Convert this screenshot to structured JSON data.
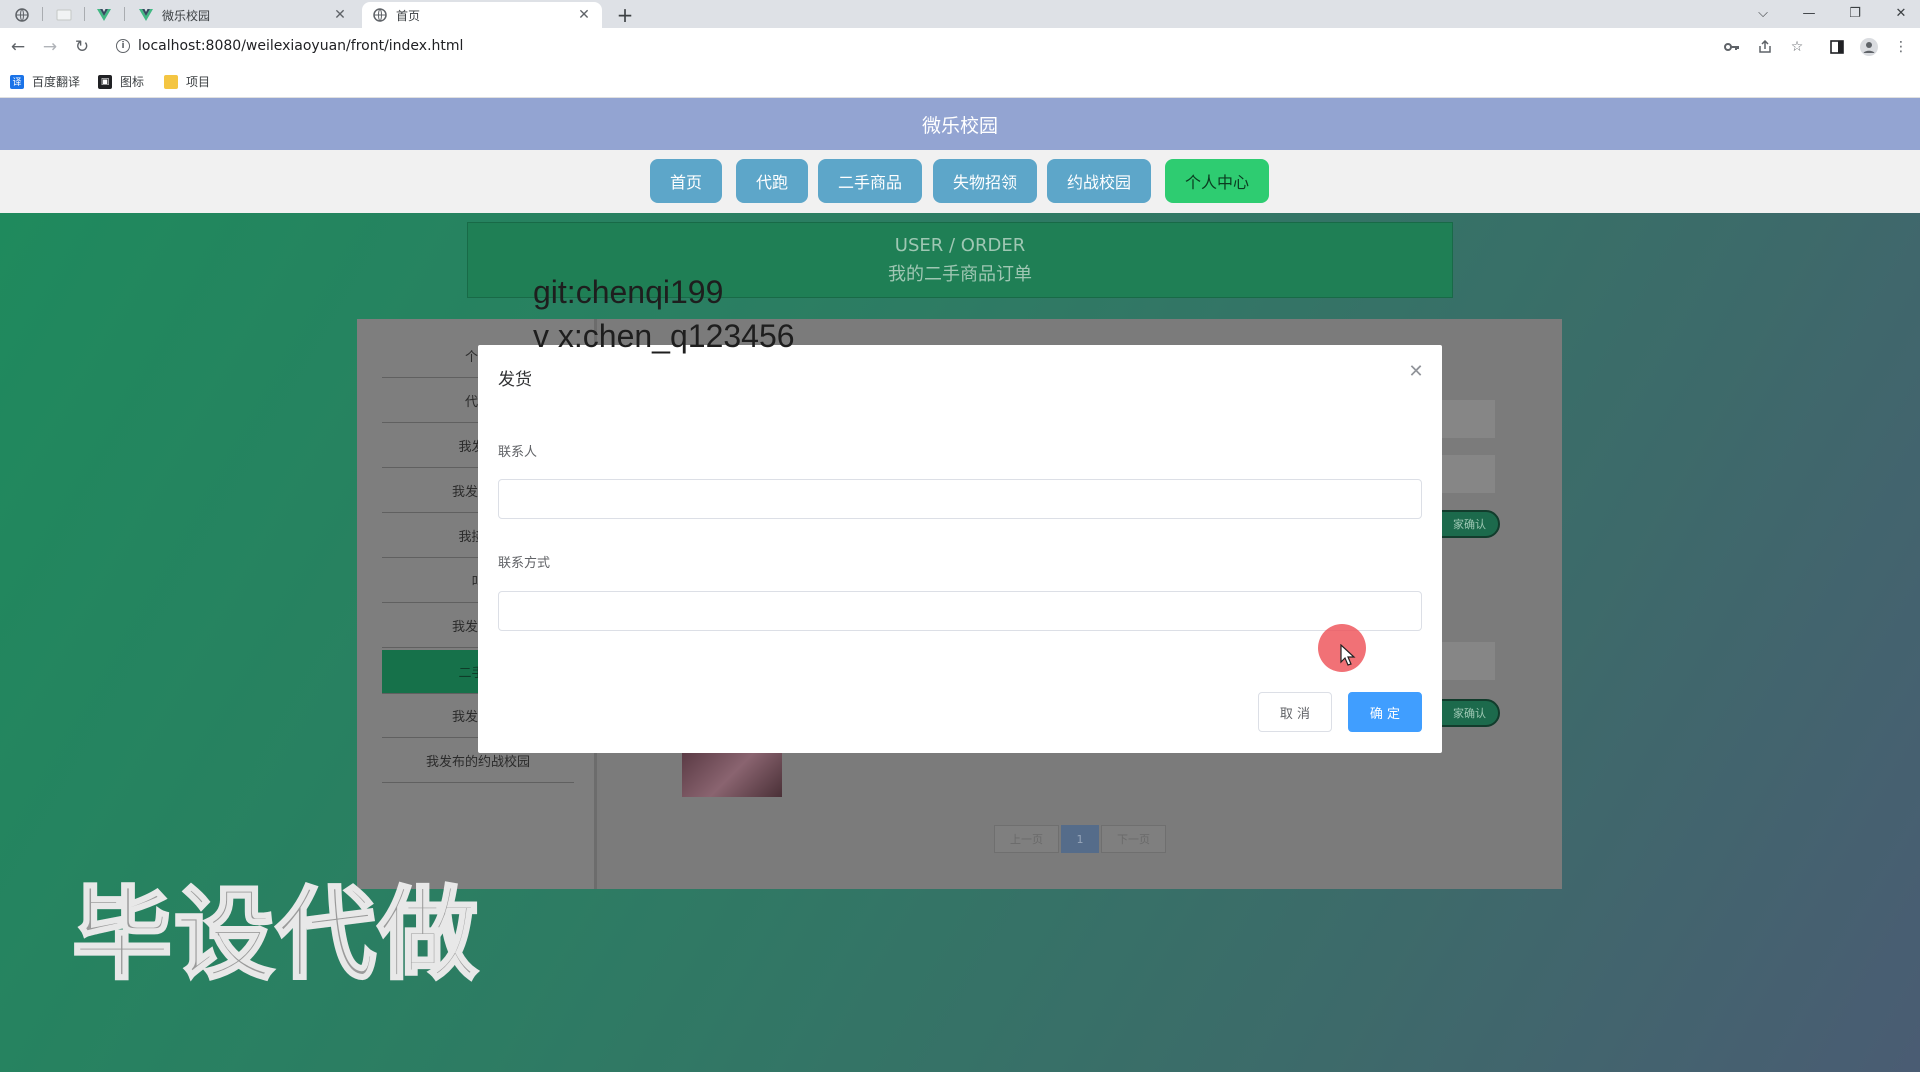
{
  "browser": {
    "tabs": [
      {
        "title": "微乐校园",
        "icon": "vue-logo-icon",
        "active": false
      },
      {
        "title": "首页",
        "icon": "globe-icon",
        "active": true
      }
    ],
    "address": "localhost:8080/weilexiaoyuan/front/index.html",
    "bookmarks": [
      {
        "label": "百度翻译",
        "icon": "translate-icon",
        "color": "#1a73e8"
      },
      {
        "label": "图标",
        "icon": "image-icon",
        "color": "#202124"
      },
      {
        "label": "项目",
        "icon": "folder-icon",
        "color": "#f4c542"
      }
    ]
  },
  "site": {
    "title": "微乐校园",
    "nav": [
      {
        "label": "首页",
        "color": "#5da6c9"
      },
      {
        "label": "代跑",
        "color": "#5da6c9"
      },
      {
        "label": "二手商品",
        "color": "#5da6c9"
      },
      {
        "label": "失物招领",
        "color": "#5da6c9"
      },
      {
        "label": "约战校园",
        "color": "#5da6c9"
      },
      {
        "label": "个人中心",
        "color": "#2ecc71"
      }
    ]
  },
  "banner": {
    "en": "USER / ORDER",
    "cn": "我的二手商品订单"
  },
  "side_menu": [
    "个人",
    "代跑",
    "我发起",
    "我发起的",
    "我接的",
    "叫",
    "我发布的",
    "二手商",
    "我发布的",
    "我发布的约战校园"
  ],
  "side_active_index": 7,
  "order_status_label": "家确认",
  "pagination": {
    "prev": "上一页",
    "current": "1",
    "next": "下一页"
  },
  "overlay_text": {
    "git": "git:chenqi199",
    "vx": "v x:chen_q123456",
    "ad": "毕设代做"
  },
  "dialog": {
    "title": "发货",
    "fields": [
      {
        "label": "联系人",
        "value": "",
        "placeholder": ""
      },
      {
        "label": "联系方式",
        "value": "",
        "placeholder": ""
      }
    ],
    "cancel": "取 消",
    "confirm": "确 定"
  },
  "colors": {
    "header": "#93a4d2",
    "accent_green": "#1f8a5d",
    "primary_blue": "#409eff"
  }
}
